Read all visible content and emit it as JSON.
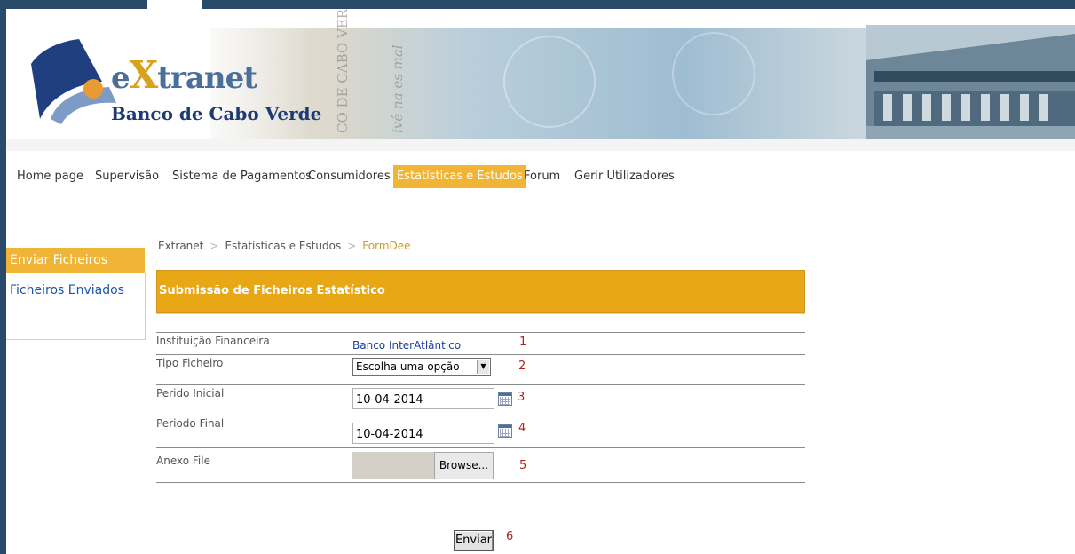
{
  "banner": {
    "brand_prefix": "e",
    "brand_x": "X",
    "brand_suffix": "tranet",
    "brand_subtitle": "Banco de Cabo Verde",
    "watermark_1": "CO DE CABO VER",
    "watermark_2": "ivê na es mal"
  },
  "nav": {
    "items": [
      {
        "label": "Home page"
      },
      {
        "label": "Supervisão"
      },
      {
        "label": "Sistema de Pagamentos"
      },
      {
        "label": "Consumidores"
      },
      {
        "label": "Estatísticas e Estudos",
        "active": true
      },
      {
        "label": "Forum"
      },
      {
        "label": "Gerir Utilizadores"
      }
    ]
  },
  "sidebar": {
    "items": [
      {
        "label": "Enviar Ficheiros",
        "active": true
      },
      {
        "label": "Ficheiros Enviados"
      }
    ]
  },
  "breadcrumb": {
    "items": [
      "Extranet",
      "Estatísticas e Estudos"
    ],
    "separator": ">",
    "current": "FormDee"
  },
  "form": {
    "title": "Submissão de Ficheiros Estatístico",
    "rows": [
      {
        "label": "Instituição Financeira",
        "value": "Banco InterAtlântico",
        "marker": "1"
      },
      {
        "label": "Tipo Ficheiro",
        "value": "Escolha uma opção",
        "marker": "2"
      },
      {
        "label": "Perido Inicial",
        "value": "10-04-2014",
        "marker": "3"
      },
      {
        "label": "Periodo Final",
        "value": "10-04-2014",
        "marker": "4"
      },
      {
        "label": "Anexo File",
        "value": "Browse...",
        "marker": "5"
      }
    ],
    "submit_label": "Enviar",
    "submit_marker": "6"
  },
  "colors": {
    "accent": "#f0b436",
    "header": "#e8a714",
    "frame": "#2a4a6b",
    "link": "#1b55a5",
    "marker": "#b22222"
  },
  "icons": {
    "calendar": "calendar-icon",
    "dropdown": "chevron-down-icon",
    "logo": "extranet-logo"
  }
}
